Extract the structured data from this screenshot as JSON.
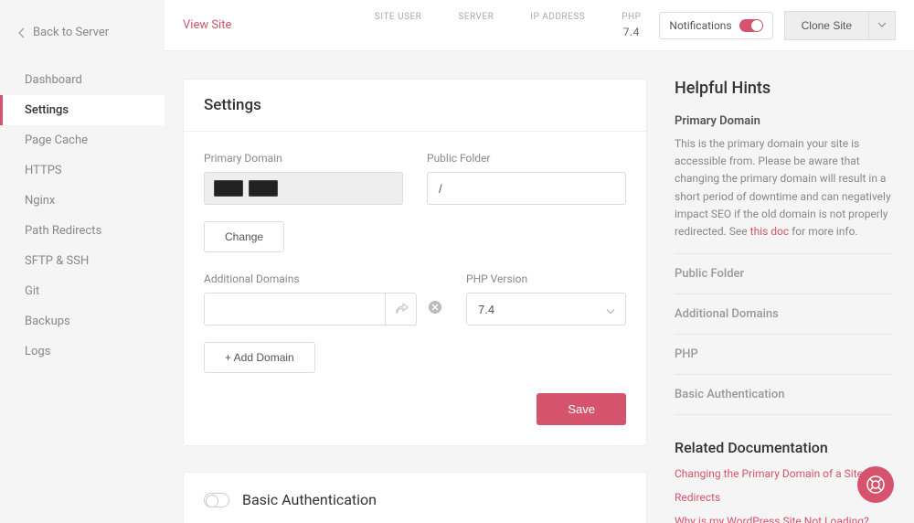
{
  "sidebar": {
    "back_label": "Back to Server",
    "items": [
      {
        "label": "Dashboard",
        "active": false
      },
      {
        "label": "Settings",
        "active": true
      },
      {
        "label": "Page Cache",
        "active": false
      },
      {
        "label": "HTTPS",
        "active": false
      },
      {
        "label": "Nginx",
        "active": false
      },
      {
        "label": "Path Redirects",
        "active": false
      },
      {
        "label": "SFTP & SSH",
        "active": false
      },
      {
        "label": "Git",
        "active": false
      },
      {
        "label": "Backups",
        "active": false
      },
      {
        "label": "Logs",
        "active": false
      }
    ]
  },
  "header": {
    "view_site": "View Site",
    "meta": {
      "site_user_label": "SITE USER",
      "server_label": "SERVER",
      "ip_label": "IP ADDRESS",
      "php_label": "PHP",
      "php_value": "7.4"
    },
    "notifications_label": "Notifications",
    "clone_label": "Clone Site"
  },
  "settings_card": {
    "title": "Settings",
    "primary_domain_label": "Primary Domain",
    "public_folder_label": "Public Folder",
    "public_folder_value": "/",
    "change_label": "Change",
    "additional_domains_label": "Additional Domains",
    "php_version_label": "PHP Version",
    "php_version_value": "7.4",
    "add_domain_label": "+ Add Domain",
    "save_label": "Save"
  },
  "ba_card": {
    "title": "Basic Authentication"
  },
  "hints": {
    "title": "Helpful Hints",
    "primary": {
      "label": "Primary Domain",
      "text_before": "This is the primary domain your site is accessible from. Please be aware that changing the primary domain will result in a short period of downtime and can negatively impact SEO if the old domain is not properly redirected. See ",
      "link_text": "this doc",
      "text_after": " for more info."
    },
    "sections": [
      {
        "label": "Public Folder"
      },
      {
        "label": "Additional Domains"
      },
      {
        "label": "PHP"
      },
      {
        "label": "Basic Authentication"
      }
    ],
    "related_title": "Related Documentation",
    "docs": [
      "Changing the Primary Domain of a Site",
      "Redirects",
      "Why is my WordPress Site Not Loading?"
    ]
  }
}
